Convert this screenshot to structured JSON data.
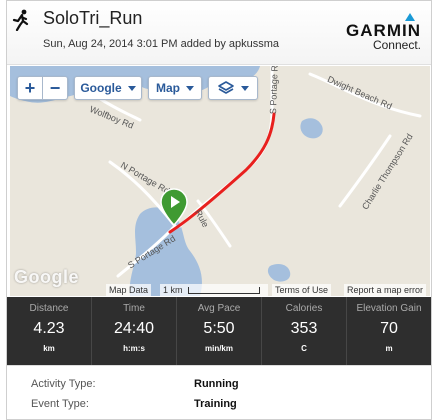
{
  "header": {
    "title": "SoloTri_Run",
    "subtitle": "Sun, Aug 24, 2014 3:01 PM added by apkussma",
    "brand_name": "GARMIN",
    "brand_product": "Connect.",
    "runner_icon": "running-person-icon",
    "accent_color": "#1a9ad6"
  },
  "map": {
    "controls": {
      "zoom_in": "+",
      "zoom_out": "−",
      "provider": "Google",
      "map_type": "Map",
      "layers_icon": "layers-icon"
    },
    "road_labels": {
      "portage_top": "S Portage Rd",
      "wolfboy": "Wolfboy Rd",
      "dwight": "Dwight Beach Rd",
      "n_portage": "N Portage Rd",
      "charlie": "Charlie Thompson Rd",
      "s_portage_bottom": "S Portage Rd",
      "rule": "Rule"
    },
    "logo": "Google",
    "footer": {
      "map_data": "Map Data",
      "scale": "1 km",
      "terms": "Terms of Use",
      "report": "Report a map error"
    },
    "route_color": "#e8201e",
    "water_color": "#a5bfdd",
    "land_color": "#eae6dc",
    "start_pin_color": "#3f9a32"
  },
  "stats": [
    {
      "label": "Distance",
      "value": "4.23",
      "unit": "km"
    },
    {
      "label": "Time",
      "value": "24:40",
      "unit": "h:m:s"
    },
    {
      "label": "Avg Pace",
      "value": "5:50",
      "unit": "min/km"
    },
    {
      "label": "Calories",
      "value": "353",
      "unit": "C"
    },
    {
      "label": "Elevation Gain",
      "value": "70",
      "unit": "m"
    }
  ],
  "details": [
    {
      "label": "Activity Type:",
      "value": "Running"
    },
    {
      "label": "Event Type:",
      "value": "Training"
    }
  ]
}
